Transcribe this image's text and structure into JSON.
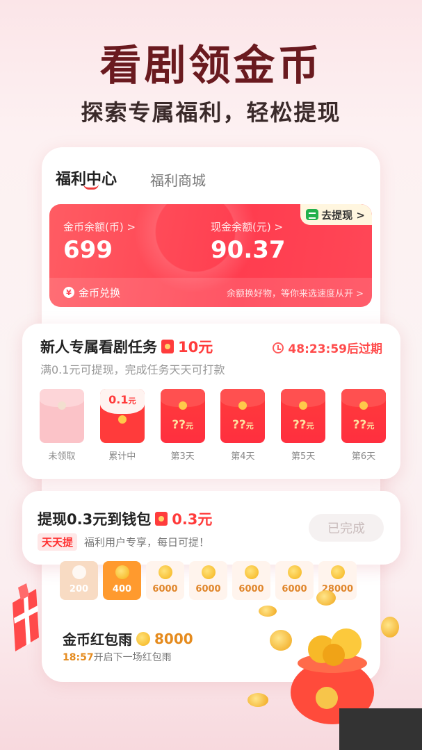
{
  "hero": {
    "title": "看剧领金币",
    "subtitle": "探索专属福利，轻松提现"
  },
  "tabs": {
    "active": "福利中心",
    "inactive": "福利商城"
  },
  "balance": {
    "withdraw_pill": "去提现 >",
    "coin_label": "金币余额(币) >",
    "coin_value": "699",
    "cash_label": "现金余额(元) >",
    "cash_value": "90.37",
    "exchange_label": "金币兑换",
    "footer_hint": "余额换好物，等你来选速度从开 >"
  },
  "task": {
    "title": "新人专属看剧任务",
    "reward": "10元",
    "timer": "48:23:59后过期",
    "desc": "满0.1元可提现，完成任务天天可打款",
    "days": [
      {
        "label": "未领取",
        "amount": ""
      },
      {
        "label": "累计中",
        "amount": "0.1",
        "unit": "元"
      },
      {
        "label": "第3天",
        "amount": "??",
        "unit": "元"
      },
      {
        "label": "第4天",
        "amount": "??",
        "unit": "元"
      },
      {
        "label": "第5天",
        "amount": "??",
        "unit": "元"
      },
      {
        "label": "第6天",
        "amount": "??",
        "unit": "元"
      }
    ]
  },
  "withdraw": {
    "title": "提现0.3元到钱包",
    "amount": "0.3元",
    "tag": "天天提",
    "sub": "福利用户专享，每日可提！",
    "button": "已完成"
  },
  "coins": [
    "200",
    "400",
    "6000",
    "6000",
    "6000",
    "6000",
    "28000"
  ],
  "rain": {
    "title": "金币红包雨",
    "amount": "8000",
    "time": "18:57",
    "sub": "开启下一场红包雨"
  }
}
